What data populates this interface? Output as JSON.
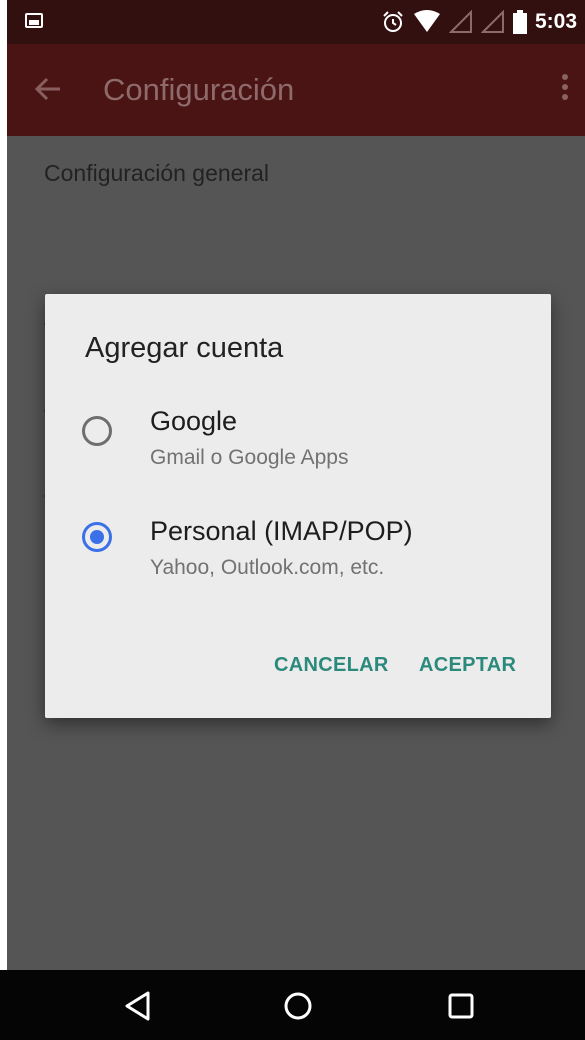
{
  "status_bar": {
    "time": "5:03",
    "icons": [
      "photo-icon",
      "alarm-icon",
      "wifi-icon",
      "signal-icon",
      "signal-icon",
      "battery-icon"
    ]
  },
  "app_bar": {
    "title": "Configuración",
    "back_icon": "arrow-back-icon",
    "menu_icon": "more-vert-icon"
  },
  "section": {
    "title": "Configuración general"
  },
  "dialog": {
    "title": "Agregar cuenta",
    "options": [
      {
        "label": "Google",
        "sublabel": "Gmail o Google Apps",
        "selected": false
      },
      {
        "label": "Personal (IMAP/POP)",
        "sublabel": "Yahoo, Outlook.com, etc.",
        "selected": true
      }
    ],
    "cancel_label": "CANCELAR",
    "accept_label": "ACEPTAR"
  },
  "nav_bar": {
    "icons": [
      "back-triangle-icon",
      "home-circle-icon",
      "recents-square-icon"
    ]
  },
  "colors": {
    "status_bar": "#331010",
    "app_bar": "#4a1414",
    "dim_background": "#555555",
    "dialog_background": "#ececec",
    "radio_selected": "#3b71e8",
    "button_text": "#2b8a7c"
  }
}
